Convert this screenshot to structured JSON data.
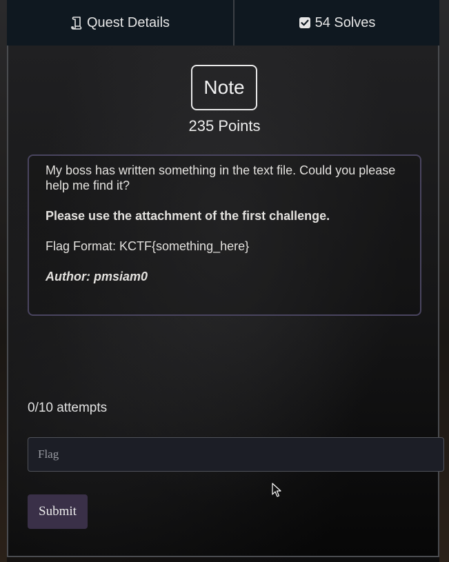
{
  "tabs": {
    "details": {
      "label": "Quest Details",
      "icon": "scroll-icon"
    },
    "solves": {
      "label": "54 Solves",
      "icon": "checkbox-icon"
    }
  },
  "challenge": {
    "name": "Note",
    "points": "235 Points",
    "description": {
      "line1": "My boss has written something in the text file. Could you please help me find it?",
      "instruction": "Please use the attachment of the first challenge.",
      "flag_format": "Flag Format: KCTF{something_here}",
      "author": "Author: pmsiam0"
    }
  },
  "submission": {
    "attempts": "0/10 attempts",
    "flag_placeholder": "Flag",
    "submit_label": "Submit"
  },
  "colors": {
    "tab_bar": "#0f1820",
    "desc_border": "#4a4560",
    "submit_bg": "#3a3048",
    "input_bg": "#1c1e26"
  }
}
